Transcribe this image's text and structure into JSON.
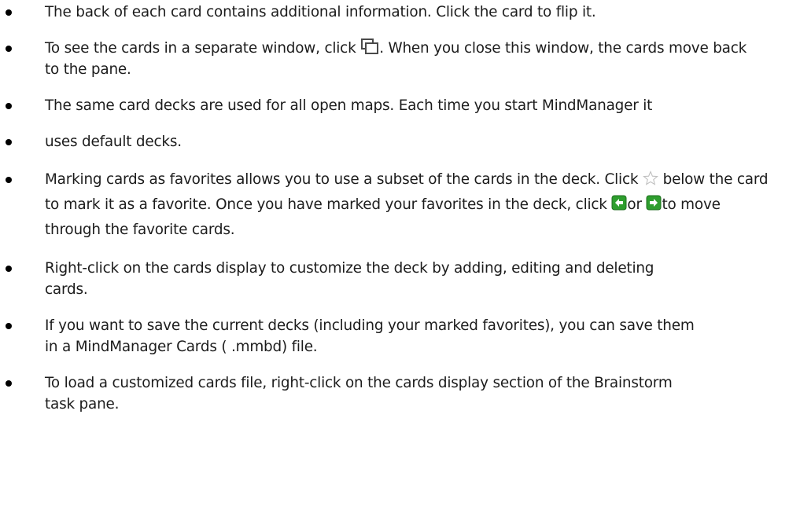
{
  "bullets": [
    {
      "a": "The back of each card contains additional information. Click the card to flip it."
    },
    {
      "a": "To see the cards in a separate window, click ",
      "b": ". When you close this window, the cards move back to the pane.",
      "icon": "new-window-icon"
    },
    {
      "a": "The same card decks are used for all open maps. Each time you start MindManager it"
    },
    {
      "a": "uses default decks."
    },
    {
      "a": "Marking cards as favorites allows you to use a subset of the cards in the deck. Click",
      "b": " below the card to mark it as a favorite. Once you have marked your favorites in the deck, click ",
      "c": "or ",
      "d": "to move through the favorite cards.",
      "icons": [
        "star-outline-icon",
        "previous-favorite-icon",
        "next-favorite-icon"
      ]
    },
    {
      "a": "Right-click on the cards display to customize the deck by adding, editing and deleting cards."
    },
    {
      "a": "If you want to save the current decks (including your marked favorites), you can save them in a MindManager Cards ( .mmbd) file."
    },
    {
      "a": "To load a customized cards file, right-click on the cards display section of the Brainstorm task pane."
    }
  ],
  "colors": {
    "text": "#1c1c1c",
    "arrow_icon_green": "#2e9e2e",
    "star_outline": "#c8c8c8"
  }
}
